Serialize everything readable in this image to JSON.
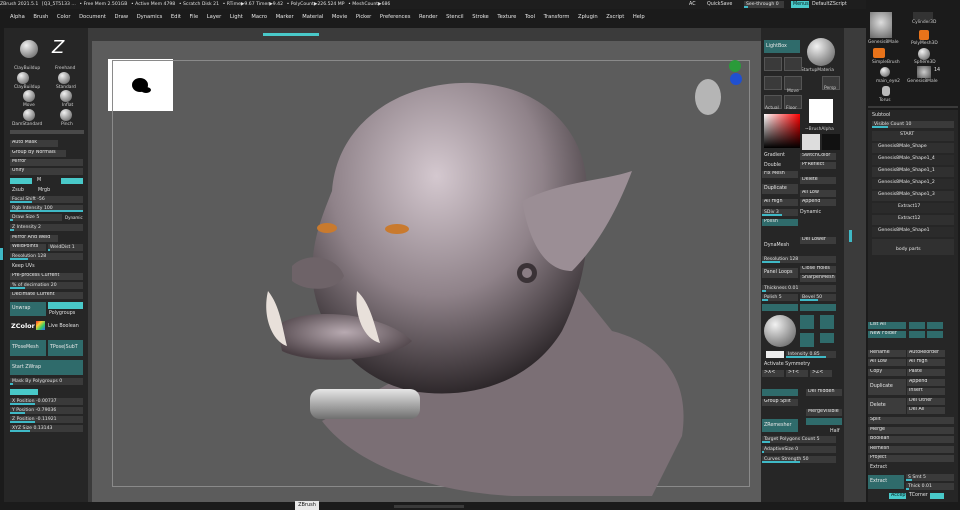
{
  "title_bar": {
    "items": [
      "ZBrush 2021.5.1",
      "[Q3_5T5133 ...",
      "• Free Mem 2.501GB",
      "• Active Mem 4798",
      "• Scratch Disk 21",
      "• RTime▶9.67 Timer▶9.42",
      "• PolyCount▶226.524 MP",
      "• MeshCount▶686"
    ],
    "right_items": [
      "AC",
      "QuickSave",
      "See-through 0",
      "Menus",
      "DefaultZScript"
    ]
  },
  "menu": [
    "Alpha",
    "Brush",
    "Color",
    "Document",
    "Draw",
    "Dynamics",
    "Edit",
    "File",
    "Layer",
    "Light",
    "Macro",
    "Marker",
    "Material",
    "Movie",
    "Picker",
    "Preferences",
    "Render",
    "Stencil",
    "Stroke",
    "Texture",
    "Tool",
    "Transform",
    "Zplugin",
    "Zscript",
    "Help"
  ],
  "left_brushes": [
    {
      "label": "ClayBuildup",
      "sub": "ClayBuildup"
    },
    {
      "label": "Freehand",
      "sub": "Standard"
    },
    {
      "label": "Move",
      "sub": "DamStandard"
    },
    {
      "label": "Inflat",
      "sub": "Pinch"
    }
  ],
  "left_panel": {
    "auto_mask": "Auto Mask",
    "group_by_normals": "Group By Normals",
    "mirror": "Mirror",
    "unify": "Unify",
    "m": "M",
    "zsub": "Zsub",
    "mrgb": "Mrgb",
    "focal_shift": "Focal Shift -56",
    "rgb_intensity": "Rgb Intensity 100",
    "draw_size": "Draw Size 5",
    "dynamic": "Dynamic",
    "z_intensity": "Z Intensity 2",
    "mirror_and_weld": "Mirror And Weld",
    "weld_points": "WeldPoints",
    "weld_dist": "WeldDist 1",
    "resolution": "Resolution 128",
    "keep_uvs": "Keep UVs",
    "pre_process_current": "Pre-process Current",
    "pct_of_decimation": "% of decimation 20",
    "decimate_current": "Decimate Current",
    "unwrap": "Unwrap",
    "polygroups": "Polygroups",
    "zcolor": "ZColor",
    "live_boolean": "Live Boolean",
    "tposemesh": "TPoseMesh",
    "tpose_subt": "TPose|SubT",
    "start_zwrap": "Start ZWrap",
    "mask_by_polygroups": "Mask By Polygroups 0",
    "x_position": "X Position -0.00737",
    "y_position": "Y Position -0.79036",
    "z_position": "Z Position -0.11921",
    "xyz_size": "XYZ Size 0.13143"
  },
  "right_mid": {
    "lightbox": "LightBox",
    "startup_material": "StartupMateria",
    "brush_alpha": "~BrushAlpha",
    "move": "Move",
    "persp": "Persp",
    "actual": "Actual",
    "floor": "Floor",
    "gradient": "Gradient",
    "switch_color": "SwitchColor",
    "double": "Double",
    "pf_reflect": "PFReflect",
    "fix_mesh": "Fix Mesh",
    "delete": "Delete",
    "duplicate": "Duplicate",
    "all_low": "All Low",
    "all_high": "All High",
    "append": "Append",
    "polish": "Polish",
    "sdiv": "SDiv 3",
    "dynamic": "Dynamic",
    "del_lower": "Del Lower",
    "dynamesh": "DynaMesh",
    "resolution": "Resolution 128",
    "panel_loops": "Panel Loops",
    "close_holes": "Close Holes",
    "sharpen_mesh": "SharpenMesh",
    "thickness": "Thickness 0.01",
    "polish2": "Polish 5",
    "bevel": "Bevel 50",
    "intensity": "Intensity 0.85",
    "activate_symmetry": "Activate Symmetry",
    "x": ">X<",
    "y": ">Y<",
    "z": ">Z<",
    "group_split": "Group Split",
    "del_hidden": "Del Hidden",
    "merge_visible": "MergeVisible",
    "zremesher": "ZRemesher",
    "half": "Half",
    "target_polygons": "Target Polygons Count 5",
    "adaptive_size": "AdaptiveSize 0",
    "curves_strength": "Curves Strength 50"
  },
  "tool_thumbs": [
    {
      "label": "Genesis8Male"
    },
    {
      "label": "Cylinder3D"
    },
    {
      "label": "SimpleBrush"
    },
    {
      "label": "PolyMesh3D"
    },
    {
      "label": "Sphere3D"
    },
    {
      "label": "main_eye2"
    },
    {
      "label": "Genesis8Male"
    },
    {
      "label": "Torus"
    }
  ],
  "tool_badge": "14",
  "subtool": {
    "header": "Subtool",
    "visible_count": "Visible Count 10",
    "items": [
      "START",
      "Genesis8Male_Shape",
      "Genesis8Male_Shape1_4",
      "Genesis8Male_Shape1_1",
      "Genesis8Male_Shape1_2",
      "Genesis8Male_Shape1_3",
      "Extract17",
      "Extract12",
      "Genesis8Male_Shape1",
      "body parts"
    ],
    "list_all": "List All",
    "new_folder": "New Folder",
    "rename": "Rename",
    "auto_reorder": "AutoReorder",
    "all_low": "All Low",
    "all_high": "All High",
    "copy": "Copy",
    "paste": "Paste",
    "duplicate": "Duplicate",
    "append": "Append",
    "insert": "Insert",
    "delete": "Delete",
    "del_other": "Del Other",
    "del_all": "Del All",
    "split": "Split",
    "merge": "Merge",
    "boolean": "Boolean",
    "remesh": "Remesh",
    "project": "Project",
    "extract_header": "Extract",
    "extract": "Extract",
    "s_smt": "S Smt 5",
    "thick": "Thick 0.01",
    "accept": "Accept",
    "tcorner": "TCorner"
  },
  "bottom_tab": "ZBrush",
  "colors": {
    "accent": "#3fb9c6",
    "active": "#49c9c9",
    "panel": "#262626"
  }
}
